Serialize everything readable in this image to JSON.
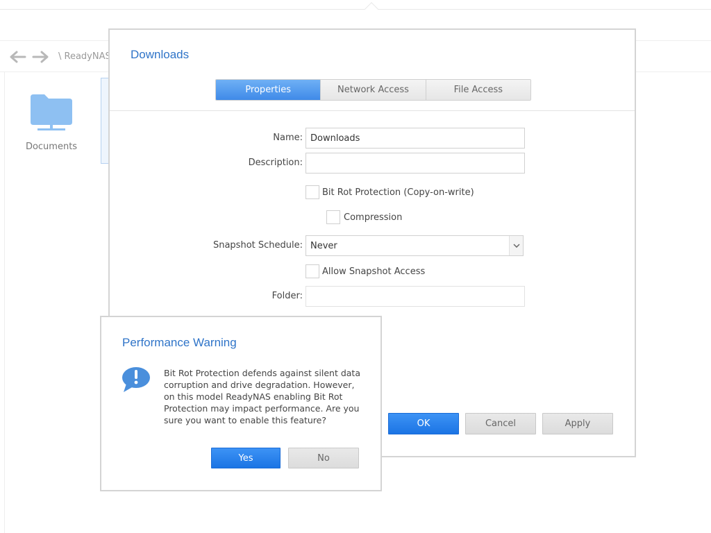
{
  "breadcrumb": {
    "text": "\\ ReadyNAS"
  },
  "folder_tile": {
    "label": "Documents"
  },
  "dialog": {
    "title": "Downloads",
    "tabs": [
      {
        "label": "Properties",
        "active": true
      },
      {
        "label": "Network Access",
        "active": false
      },
      {
        "label": "File Access",
        "active": false
      }
    ],
    "fields": {
      "name_label": "Name:",
      "name_value": "Downloads",
      "description_label": "Description:",
      "description_value": "",
      "bitrot_label": "Bit Rot Protection (Copy-on-write)",
      "bitrot_checked": false,
      "compression_label": "Compression",
      "compression_checked": false,
      "snapshot_label": "Snapshot Schedule:",
      "snapshot_value": "Never",
      "allow_snapshot_label": "Allow Snapshot Access",
      "allow_snapshot_checked": false,
      "folder_label": "Folder:",
      "folder_value": ""
    },
    "buttons": {
      "ok": "OK",
      "cancel": "Cancel",
      "apply": "Apply"
    }
  },
  "warning": {
    "title": "Performance Warning",
    "message": "Bit Rot Protection defends against silent data corruption and drive degradation. However, on this model ReadyNAS enabling Bit Rot Protection may impact performance. Are you sure you want to enable this feature?",
    "buttons": {
      "yes": "Yes",
      "no": "No"
    }
  },
  "colors": {
    "accent": "#2f74c8",
    "primary_button": "#1b74e4",
    "folder_icon": "#8ec0f2"
  },
  "icons": [
    "back-arrow-icon",
    "forward-arrow-icon",
    "shared-folder-icon",
    "warning-speech-icon",
    "chevron-down-icon"
  ]
}
